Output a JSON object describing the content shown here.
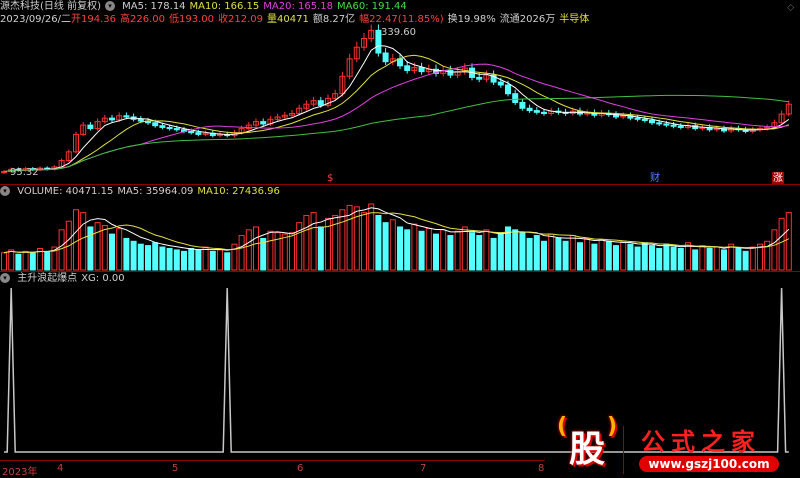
{
  "header": {
    "title": "源杰科技(日线 前复权)",
    "ma5": "MA5: 178.14",
    "ma10": "MA10: 166.15",
    "ma20": "MA20: 165.18",
    "ma60": "MA60: 191.44",
    "date": "2023/09/26/二",
    "open": "开194.36",
    "high": "高226.00",
    "low": "低193.00",
    "close": "收212.09",
    "vol": "量40471",
    "amount": "额8.27亿",
    "change": "幅22.47(11.85%)",
    "turnover": "换19.98%",
    "float": "流通2026万",
    "sector": "半导体"
  },
  "price_pane": {
    "high_label": "339.60",
    "low_label": "95.32",
    "markers": [
      "$",
      "财",
      "涨"
    ]
  },
  "volume_pane": {
    "volume": "VOLUME: 40471.15",
    "ma5": "MA5: 35964.09",
    "ma10": "MA10: 27436.96"
  },
  "indicator_pane": {
    "name": "主升浪起爆点",
    "xg": "XG: 0.00"
  },
  "axis": {
    "labels": [
      "2023年",
      "4",
      "5",
      "6",
      "7",
      "8"
    ]
  },
  "logo": {
    "icon_text": "股",
    "title": "公式之家",
    "url": "www.gszj100.com"
  },
  "colors": {
    "up": "#ff3030",
    "down": "#54ffff",
    "ma5": "#ffffff",
    "ma10": "#e0e040",
    "ma20": "#e040e0",
    "ma60": "#40c040"
  },
  "chart_data": {
    "type": "candlestick",
    "closes": [
      96,
      100,
      98,
      101,
      99,
      102,
      100,
      104,
      115,
      130,
      160,
      176,
      170,
      182,
      188,
      185,
      192,
      190,
      186,
      183,
      180,
      175,
      172,
      170,
      168,
      165,
      163,
      160,
      162,
      158,
      160,
      158,
      163,
      170,
      176,
      182,
      178,
      186,
      190,
      193,
      196,
      205,
      212,
      218,
      210,
      222,
      230,
      260,
      290,
      310,
      325,
      339,
      300,
      285,
      290,
      278,
      270,
      275,
      268,
      272,
      265,
      270,
      262,
      268,
      274,
      258,
      255,
      262,
      250,
      245,
      230,
      215,
      205,
      201,
      198,
      196,
      200,
      198,
      196,
      200,
      195,
      197,
      193,
      196,
      194,
      190,
      192,
      188,
      186,
      184,
      180,
      178,
      176,
      174,
      172,
      175,
      170,
      172,
      168,
      170,
      166,
      170,
      168,
      165,
      168,
      170,
      172,
      180,
      195,
      212
    ],
    "volumes": [
      12,
      14,
      11,
      13,
      12,
      15,
      13,
      16,
      28,
      34,
      42,
      40,
      30,
      33,
      31,
      25,
      29,
      22,
      20,
      18,
      17,
      19,
      16,
      15,
      14,
      13,
      15,
      14,
      16,
      13,
      14,
      12,
      18,
      24,
      28,
      30,
      22,
      27,
      26,
      25,
      26,
      33,
      38,
      40,
      30,
      36,
      38,
      42,
      45,
      44,
      40,
      46,
      38,
      33,
      35,
      30,
      28,
      32,
      27,
      29,
      25,
      28,
      24,
      27,
      30,
      26,
      24,
      28,
      22,
      26,
      30,
      28,
      26,
      22,
      24,
      20,
      25,
      22,
      20,
      24,
      19,
      22,
      18,
      21,
      20,
      17,
      20,
      18,
      16,
      19,
      17,
      15,
      18,
      16,
      15,
      19,
      14,
      17,
      15,
      16,
      14,
      18,
      15,
      13,
      16,
      18,
      20,
      28,
      36,
      40
    ],
    "signals": [
      1,
      31,
      108
    ],
    "price_range": [
      95.32,
      339.6
    ]
  }
}
